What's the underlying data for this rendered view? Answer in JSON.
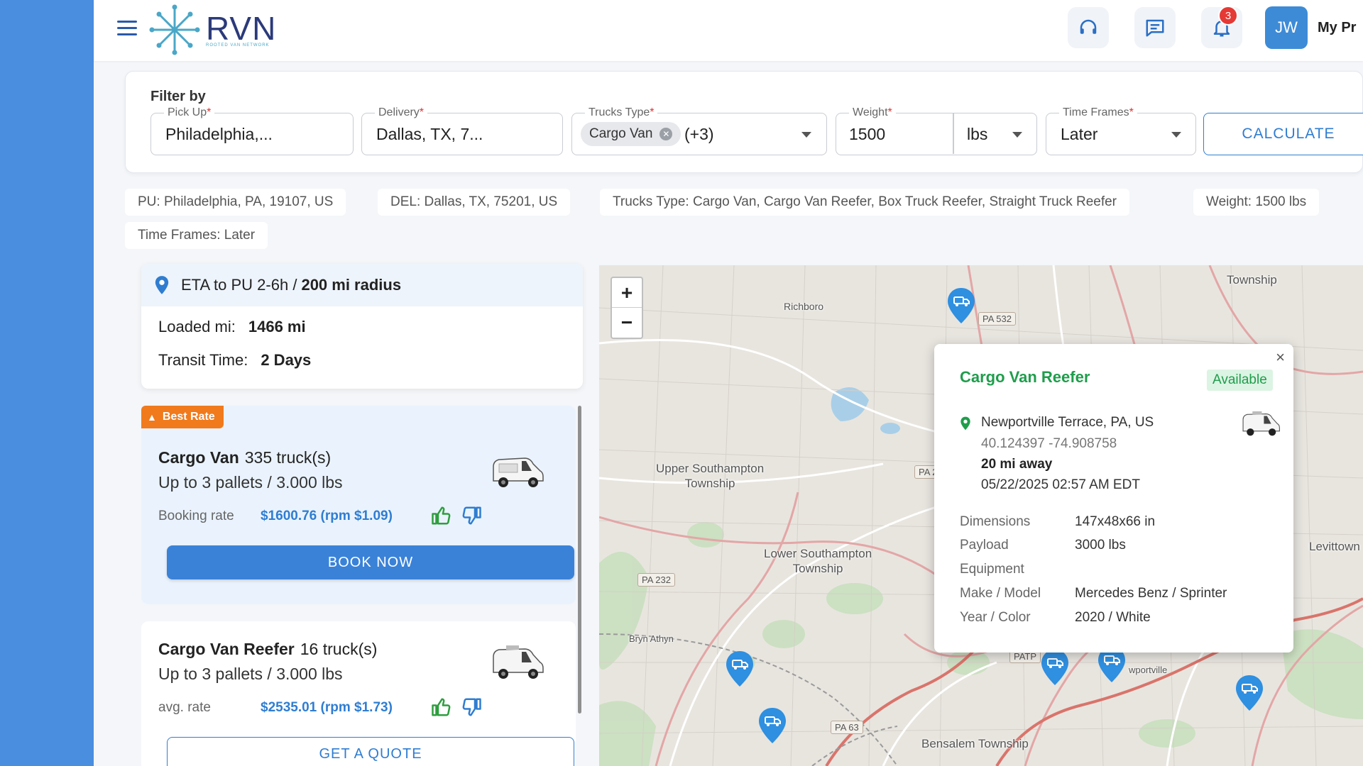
{
  "app": {
    "logo_text": "RVN",
    "logo_sub": "ROOTED VAN NETWORK",
    "notifications_count": "3",
    "avatar_initials": "JW",
    "profile_label": "My Pr"
  },
  "filter": {
    "title": "Filter by",
    "pickup": {
      "label": "Pick Up",
      "value": "Philadelphia,..."
    },
    "delivery": {
      "label": "Delivery",
      "value": "Dallas, TX, 7..."
    },
    "trucks_type": {
      "label": "Trucks Type",
      "chip": "Cargo Van",
      "more": "(+3)"
    },
    "weight": {
      "label": "Weight",
      "value": "1500",
      "unit": "lbs"
    },
    "time_frames": {
      "label": "Time Frames",
      "value": "Later"
    },
    "required_mark": "*",
    "calculate_label": "CALCULATE"
  },
  "tags": [
    "PU: Philadelphia, PA, 19107, US",
    "DEL: Dallas, TX, 75201, US",
    "Trucks Type: Cargo Van, Cargo Van Reefer, Box Truck Reefer, Straight Truck Reefer",
    "Weight: 1500 lbs",
    "Time Frames: Later"
  ],
  "summary": {
    "eta": "ETA to PU 2-6h /",
    "radius": "200 mi radius",
    "loaded_label": "Loaded mi:",
    "loaded_value": "1466 mi",
    "transit_label": "Transit Time:",
    "transit_value": "2 Days"
  },
  "offers": [
    {
      "badge": "Best Rate",
      "name": "Cargo Van",
      "count": "335 truck(s)",
      "capacity": "Up to 3 pallets / 3.000 lbs",
      "rate_label": "Booking rate",
      "rate": "$1600.76 (rpm $1.09)",
      "action": "BOOK NOW"
    },
    {
      "name": "Cargo Van Reefer",
      "count": "16 truck(s)",
      "capacity": "Up to 3 pallets / 3.000 lbs",
      "rate_label": "avg. rate",
      "rate": "$2535.01 (rpm $1.73)",
      "action": "GET A QUOTE"
    }
  ],
  "map": {
    "zoom_in": "+",
    "zoom_out": "−",
    "labels": {
      "township_top": "Township",
      "richboro": "Richboro",
      "upper_southampton": "Upper Southampton\nTownship",
      "lower_southampton": "Lower Southampton\nTownship",
      "levittown": "Levittown",
      "bryn_athyn": "Bryn Athyn",
      "bensalem": "Bensalem Township",
      "newportville": "wportville"
    },
    "roads": {
      "pa532": "PA 532",
      "pa232": "PA 232",
      "pa63": "PA 63",
      "pa_partial": "PA 2",
      "patp": "PATP"
    }
  },
  "popup": {
    "title": "Cargo Van Reefer",
    "status": "Available",
    "location": "Newportville Terrace, PA, US",
    "coords": "40.124397 -74.908758",
    "distance": "20 mi  away",
    "timestamp": "05/22/2025 02:57 AM EDT",
    "close": "×",
    "details": [
      {
        "k": "Dimensions",
        "v": "147x48x66 in"
      },
      {
        "k": "Payload",
        "v": "3000 lbs"
      },
      {
        "k": "Equipment",
        "v": ""
      },
      {
        "k": "Make / Model",
        "v": "Mercedes Benz / Sprinter"
      },
      {
        "k": "Year / Color",
        "v": "2020 / White"
      }
    ]
  },
  "colors": {
    "brand_blue": "#2f7dd1",
    "rail_blue": "#4a8ee0",
    "available_green": "#1f9d4c",
    "best_rate_orange": "#f07a1c"
  }
}
